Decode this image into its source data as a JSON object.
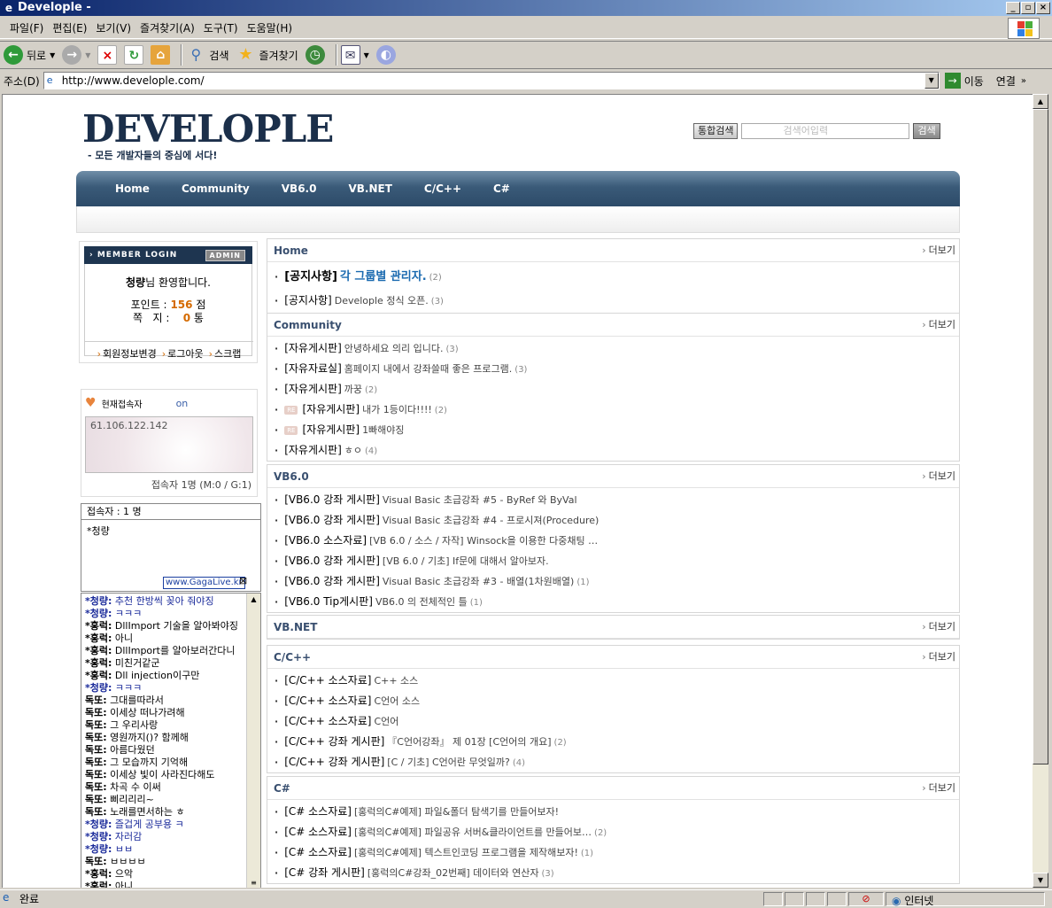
{
  "window": {
    "title": "Develople -"
  },
  "menu": [
    "파일(F)",
    "편집(E)",
    "보기(V)",
    "즐겨찾기(A)",
    "도구(T)",
    "도움말(H)"
  ],
  "toolbar": {
    "back": "뒤로",
    "search": "검색",
    "favorites": "즐겨찾기"
  },
  "address": {
    "label": "주소(D)",
    "url": "http://www.develople.com/",
    "go": "이동",
    "links": "연결"
  },
  "status": {
    "text": "완료",
    "zone": "인터넷"
  },
  "site": {
    "logo": "DEVELOPLE",
    "slogan": "- 모든 개발자들의 중심에 서다!",
    "search_all": "통합검색",
    "search_placeholder": "검색어입력",
    "search_btn": "검색",
    "nav": [
      "Home",
      "Community",
      "VB6.0",
      "VB.NET",
      "C/C++",
      "C#"
    ]
  },
  "login": {
    "header": "› MEMBER LOGIN",
    "admin": "ADMIN",
    "user": "청량",
    "welcome_suffix": "님 환영합니다.",
    "points_label": "포인트 :",
    "points": "156",
    "points_unit": "점",
    "notes_label": "쪽   지 :",
    "notes": "0",
    "notes_unit": "통",
    "links": [
      "회원정보변경",
      "로그아웃",
      "스크랩"
    ]
  },
  "visitor": {
    "label": "현재접속자",
    "status": "on",
    "ip": "61.106.122.142",
    "count": "접속자 1명 (M:0 / G:1)"
  },
  "chat": {
    "users_header": "접속자 : 1 명",
    "users": "*청량",
    "gaga": "www.GagaLive.kr",
    "lines": [
      {
        "n": "*청량:",
        "t": "추천 한방씩 꽂아 줘야징",
        "s": 1
      },
      {
        "n": "*청량:",
        "t": "ㅋㅋㅋ",
        "s": 1
      },
      {
        "n": "*홍럭:",
        "t": "DllImport 기술을 알아봐야징",
        "s": 2
      },
      {
        "n": "*홍럭:",
        "t": "아니",
        "s": 2
      },
      {
        "n": "*홍럭:",
        "t": "DllImport를 알아보러간다니",
        "s": 2
      },
      {
        "n": "*홍럭:",
        "t": "미친거같군",
        "s": 2
      },
      {
        "n": "*홍럭:",
        "t": "Dll injection이구만",
        "s": 2
      },
      {
        "n": "*청량:",
        "t": "ㅋㅋㅋ",
        "s": 1
      },
      {
        "n": "독또:",
        "t": "그대를따라서",
        "s": 2
      },
      {
        "n": "독또:",
        "t": "이세상 떠나가려해",
        "s": 2
      },
      {
        "n": "독또:",
        "t": "그 우리사랑",
        "s": 2
      },
      {
        "n": "독또:",
        "t": "영원까지()? 함께해",
        "s": 2
      },
      {
        "n": "독또:",
        "t": "아름다웠던",
        "s": 2
      },
      {
        "n": "독또:",
        "t": "그 모습까지 기억해",
        "s": 2
      },
      {
        "n": "독또:",
        "t": "이세상 빛이 사라진다해도",
        "s": 2
      },
      {
        "n": "독또:",
        "t": "차곡 수 이써",
        "s": 2
      },
      {
        "n": "독또:",
        "t": "삐리리리~",
        "s": 2
      },
      {
        "n": "독또:",
        "t": "노래를면서하는 ㅎ",
        "s": 2
      },
      {
        "n": "*청량:",
        "t": "즐겁게 공부용 ㅋ",
        "s": 1
      },
      {
        "n": "*청량:",
        "t": "자러감",
        "s": 1
      },
      {
        "n": "*청량:",
        "t": "ㅂㅂ",
        "s": 1
      },
      {
        "n": "독또:",
        "t": "ㅂㅂㅂㅂ",
        "s": 2
      },
      {
        "n": "*홍럭:",
        "t": "으악",
        "s": 2
      },
      {
        "n": "*홍럭:",
        "t": "아니",
        "s": 2
      }
    ]
  },
  "sections": [
    {
      "title": "Home",
      "more": "더보기",
      "items": [
        {
          "cat": "[공지사항]",
          "title": "각 그룹별 관리자.",
          "count": "(2)",
          "big": true
        },
        {
          "cat": "[공지사항]",
          "title": "Develople 정식 오픈.",
          "count": "(3)"
        }
      ]
    },
    {
      "title": "Community",
      "more": "더보기",
      "items": [
        {
          "cat": "[자유게시판]",
          "title": "안녕하세요 의리 입니다.",
          "count": "(3)"
        },
        {
          "cat": "[자유자료실]",
          "title": "홈페이지 내에서 강좌쓸때 좋은 프로그램.",
          "count": "(3)"
        },
        {
          "cat": "[자유게시판]",
          "title": "까꿍",
          "count": "(2)"
        },
        {
          "cat": "[자유게시판]",
          "title": "내가 1등이다!!!!",
          "count": "(2)",
          "re": true
        },
        {
          "cat": "[자유게시판]",
          "title": "1빠해야징",
          "count": "",
          "re": true
        },
        {
          "cat": "[자유게시판]",
          "title": "ㅎㅇ",
          "count": "(4)"
        }
      ]
    },
    {
      "title": "VB6.0",
      "more": "더보기",
      "items": [
        {
          "cat": "[VB6.0 강좌 게시판]",
          "title": "Visual Basic 초급강좌 #5 - ByRef 와 ByVal",
          "count": ""
        },
        {
          "cat": "[VB6.0 강좌 게시판]",
          "title": "Visual Basic 초급강좌 #4 - 프로시져(Procedure)",
          "count": ""
        },
        {
          "cat": "[VB6.0 소스자료]",
          "title": "[VB 6.0 / 소스 / 자작] Winsock을 이용한 다중채팅 …",
          "count": ""
        },
        {
          "cat": "[VB6.0 강좌 게시판]",
          "title": "[VB 6.0 / 기초] If문에 대해서 알아보자.",
          "count": ""
        },
        {
          "cat": "[VB6.0 강좌 게시판]",
          "title": "Visual Basic 초급강좌 #3 - 배열(1차원배열)",
          "count": "(1)"
        },
        {
          "cat": "[VB6.0 Tip게시판]",
          "title": "VB6.0 의 전체적인 틀",
          "count": "(1)"
        }
      ]
    },
    {
      "title": "VB.NET",
      "more": "더보기",
      "items": []
    },
    {
      "title": "C/C++",
      "more": "더보기",
      "items": [
        {
          "cat": "[C/C++ 소스자료]",
          "title": "C++ 소스",
          "count": ""
        },
        {
          "cat": "[C/C++ 소스자료]",
          "title": "C언어 소스",
          "count": ""
        },
        {
          "cat": "[C/C++ 소스자료]",
          "title": "C언어",
          "count": ""
        },
        {
          "cat": "[C/C++ 강좌 게시판]",
          "title": "『C언어강좌』 제 01장 [C언어의 개요]",
          "count": "(2)"
        },
        {
          "cat": "[C/C++ 강좌 게시판]",
          "title": "[C / 기초] C언어란 무엇일까?",
          "count": "(4)"
        }
      ]
    },
    {
      "title": "C#",
      "more": "더보기",
      "items": [
        {
          "cat": "[C# 소스자료]",
          "title": "[홍럭의C#예제] 파일&폴더 탐색기를 만들어보자!",
          "count": ""
        },
        {
          "cat": "[C# 소스자료]",
          "title": "[홍럭의C#예제] 파일공유 서버&클라이언트를 만들어보…",
          "count": "(2)"
        },
        {
          "cat": "[C# 소스자료]",
          "title": "[홍럭의C#예제] 텍스트인코딩 프로그램을 제작해보자!",
          "count": "(1)"
        },
        {
          "cat": "[C# 강좌 게시판]",
          "title": "[홍럭의C#강좌_02번째] 데이터와 연산자",
          "count": "(3)"
        }
      ]
    }
  ]
}
